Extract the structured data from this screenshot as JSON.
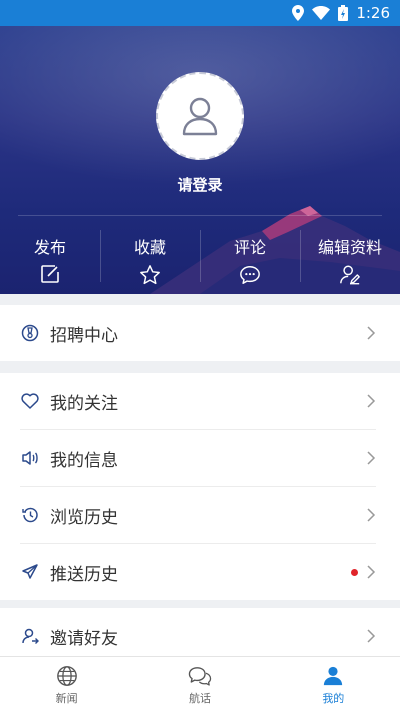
{
  "status_bar": {
    "time": "1:26"
  },
  "profile": {
    "login_label": "请登录"
  },
  "actions": [
    {
      "label": "发布",
      "icon": "edit-icon"
    },
    {
      "label": "收藏",
      "icon": "star-icon"
    },
    {
      "label": "评论",
      "icon": "comment-icon"
    },
    {
      "label": "编辑资料",
      "icon": "user-edit-icon"
    }
  ],
  "menu": {
    "recruit": "招聘中心",
    "follow": "我的关注",
    "messages": "我的信息",
    "history": "浏览历史",
    "push_history": "推送历史",
    "invite": "邀请好友"
  },
  "nav": [
    {
      "label": "新闻",
      "icon": "globe-icon",
      "active": false
    },
    {
      "label": "航话",
      "icon": "chat-icon",
      "active": false
    },
    {
      "label": "我的",
      "icon": "person-icon",
      "active": true
    }
  ],
  "colors": {
    "accent": "#1a7fd6",
    "header": "#26337f",
    "badge": "#e0242a"
  }
}
